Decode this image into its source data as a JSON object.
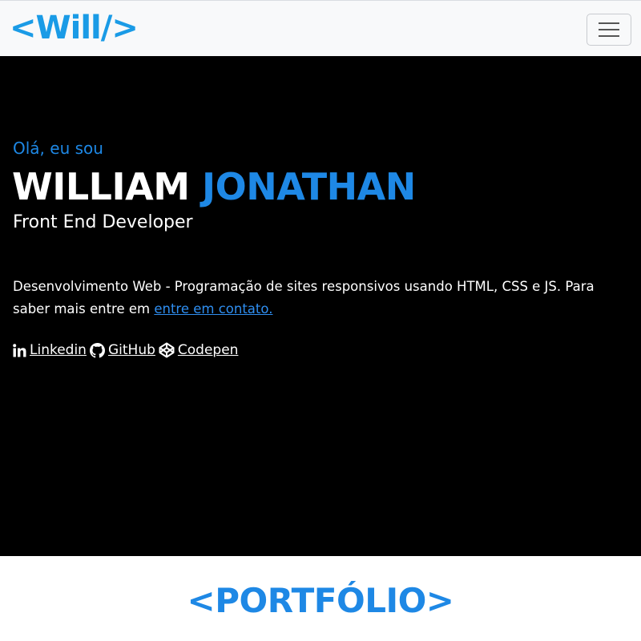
{
  "navbar": {
    "brand": "<Will/>",
    "toggler_icon": "hamburger-icon"
  },
  "hero": {
    "greeting": "Olá, eu sou",
    "name_first": "WILLIAM",
    "name_last": "JONATHAN",
    "role": "Front End Developer",
    "description": "Desenvolvimento Web - Programação de sites responsivos usando HTML, CSS e JS. Para saber mais entre em ",
    "contact_link": "entre em contato.",
    "social": [
      {
        "icon": "linkedin-icon",
        "label": "Linkedin"
      },
      {
        "icon": "github-icon",
        "label": "GitHub"
      },
      {
        "icon": "codepen-icon",
        "label": "Codepen"
      }
    ]
  },
  "portfolio": {
    "title": "<PORTFÓLIO>"
  },
  "colors": {
    "accent": "#1e88e5",
    "hero_bg": "#000000",
    "navbar_bg": "#f8f9fa"
  }
}
